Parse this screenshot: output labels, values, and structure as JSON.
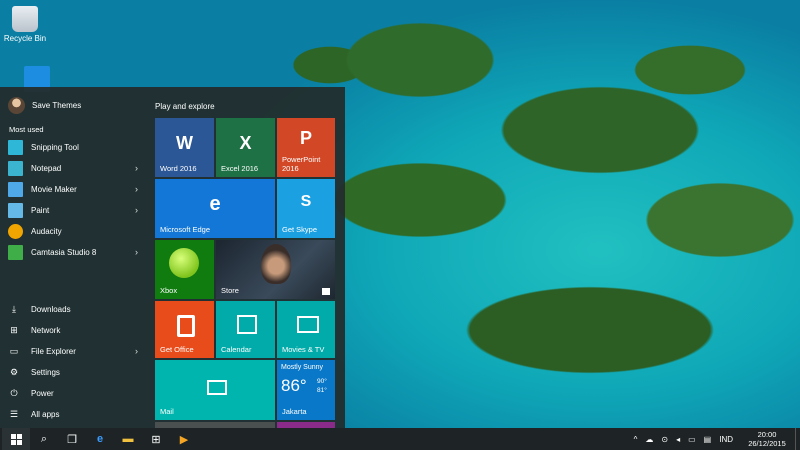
{
  "desktop": {
    "icons": [
      {
        "label": "Recycle Bin",
        "icon": "recycle-bin-icon"
      },
      {
        "label": "",
        "icon": "folder-icon"
      }
    ]
  },
  "start_menu": {
    "user_name": "Save Themes",
    "most_used_label": "Most used",
    "most_used": [
      {
        "label": "Snipping Tool",
        "color": "#2fb7d8",
        "has_submenu": false
      },
      {
        "label": "Notepad",
        "color": "#3bb5cf",
        "has_submenu": true
      },
      {
        "label": "Movie Maker",
        "color": "#4fa8e8",
        "has_submenu": true
      },
      {
        "label": "Paint",
        "color": "#64b9e6",
        "has_submenu": true
      },
      {
        "label": "Audacity",
        "color": "#f0a500",
        "has_submenu": false
      },
      {
        "label": "Camtasia Studio 8",
        "color": "#3fae49",
        "has_submenu": true
      }
    ],
    "system_items": [
      {
        "label": "Downloads",
        "icon": "download-icon",
        "has_submenu": false
      },
      {
        "label": "Network",
        "icon": "network-icon",
        "has_submenu": false
      },
      {
        "label": "File Explorer",
        "icon": "folder-icon",
        "has_submenu": true
      },
      {
        "label": "Settings",
        "icon": "gear-icon",
        "has_submenu": false
      },
      {
        "label": "Power",
        "icon": "power-icon",
        "has_submenu": false
      },
      {
        "label": "All apps",
        "icon": "list-icon",
        "has_submenu": false
      }
    ],
    "group_label": "Play and explore",
    "tiles": {
      "word": {
        "label": "Word 2016",
        "color": "#2b5797"
      },
      "excel": {
        "label": "Excel 2016",
        "color": "#1e7145"
      },
      "powerpoint": {
        "label": "PowerPoint 2016",
        "color": "#d24726"
      },
      "edge": {
        "label": "Microsoft Edge",
        "color": "#1277d6"
      },
      "skype": {
        "label": "Get Skype",
        "color": "#1ba1e2"
      },
      "xbox": {
        "label": "Xbox",
        "color": "#107c10"
      },
      "store": {
        "label": "Store",
        "color": "#2a3340"
      },
      "office": {
        "label": "Get Office",
        "color": "#e74c1a"
      },
      "calendar": {
        "label": "Calendar",
        "color": "#00aba9"
      },
      "movies": {
        "label": "Movies & TV",
        "color": "#00aba9"
      },
      "mail": {
        "label": "Mail",
        "color": "#00b5ad"
      },
      "weather": {
        "label": "Jakarta",
        "condition": "Mostly Sunny",
        "temp": "86°",
        "high": "90°",
        "low": "81°",
        "color": "#0a78c8"
      }
    }
  },
  "taskbar": {
    "language": "IND",
    "time": "20:00",
    "date": "26/12/2015"
  }
}
